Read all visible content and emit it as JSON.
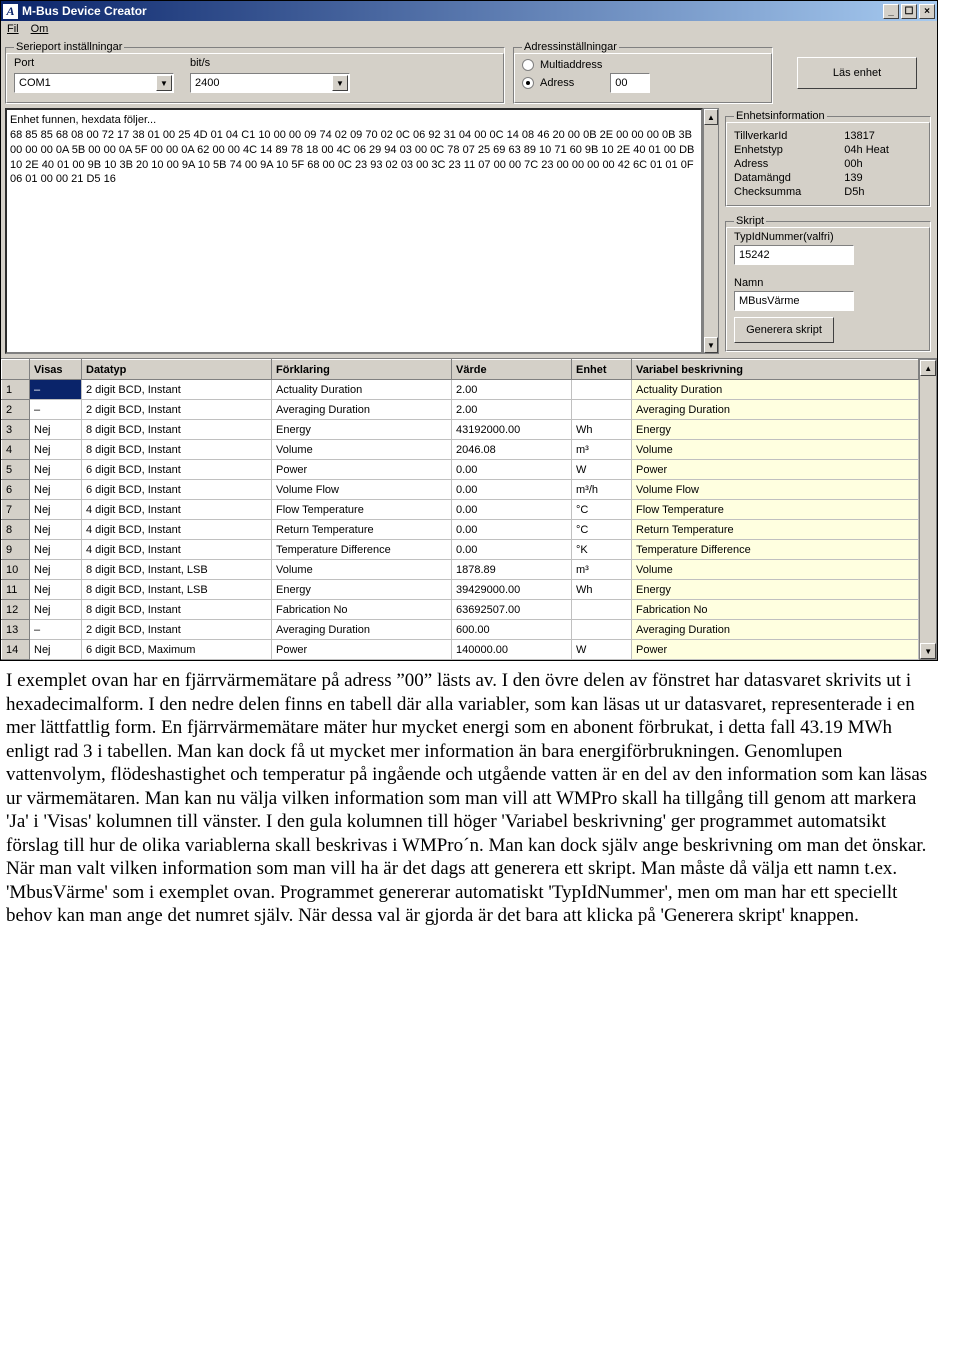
{
  "window": {
    "title": "M-Bus Device Creator",
    "menu": {
      "fil": "Fil",
      "om": "Om"
    }
  },
  "serieport": {
    "legend": "Serieport inställningar",
    "port_label": "Port",
    "port_value": "COM1",
    "bits_label": "bit/s",
    "bits_value": "2400"
  },
  "addr": {
    "legend": "Adressinställningar",
    "multi": "Multiaddress",
    "single": "Adress",
    "value": "00"
  },
  "read_btn": "Läs enhet",
  "hex": "Enhet funnen, hexdata följer...\n68 85 85 68 08 00 72 17 38 01 00 25 4D 01 04 C1 10 00 00 09 74 02 09 70 02 0C 06 92 31 04 00 0C 14 08 46 20 00 0B 2E 00 00 00 0B 3B 00 00 00 0A 5B 00 00 0A 5F 00 00 0A 62 00 00 4C 14 89 78 18 00 4C 06 29 94 03 00 0C 78 07 25 69 63 89 10 71 60 9B 10 2E 40 01 00 DB 10 2E 40 01 00 9B 10 3B 20 10 00 9A 10 5B 74 00 9A 10 5F 68 00 0C 23 93 02 03 00 3C 23 11 07 00 00 7C 23 00 00 00 00 42 6C 01 01 0F 06 01 00 00 21 D5 16",
  "enhet": {
    "legend": "Enhetsinformation",
    "k_manuf": "TillverkarId",
    "v_manuf": "13817",
    "k_type": "Enhetstyp",
    "v_type": "04h Heat",
    "k_addr": "Adress",
    "v_addr": "00h",
    "k_len": "Datamängd",
    "v_len": "139",
    "k_chk": "Checksumma",
    "v_chk": "D5h"
  },
  "skript": {
    "legend": "Skript",
    "typid_label": "TypIdNummer(valfri)",
    "typid": "15242",
    "name_label": "Namn",
    "name": "MBusVärme",
    "gen": "Generera skript"
  },
  "table": {
    "headers": [
      "",
      "Visas",
      "Datatyp",
      "Förklaring",
      "Värde",
      "Enhet",
      "Variabel beskrivning"
    ],
    "rows": [
      {
        "n": "1",
        "visas": "–",
        "dt": "2 digit BCD, Instant",
        "f": "Actuality Duration",
        "v": "2.00",
        "e": "",
        "vb": "Actuality Duration",
        "sel": true
      },
      {
        "n": "2",
        "visas": "–",
        "dt": "2 digit BCD, Instant",
        "f": "Averaging Duration",
        "v": "2.00",
        "e": "",
        "vb": "Averaging Duration"
      },
      {
        "n": "3",
        "visas": "Nej",
        "dt": "8 digit BCD, Instant",
        "f": "Energy",
        "v": "43192000.00",
        "e": "Wh",
        "vb": "Energy"
      },
      {
        "n": "4",
        "visas": "Nej",
        "dt": "8 digit BCD, Instant",
        "f": "Volume",
        "v": "2046.08",
        "e": "m³",
        "vb": "Volume"
      },
      {
        "n": "5",
        "visas": "Nej",
        "dt": "6 digit BCD, Instant",
        "f": "Power",
        "v": "0.00",
        "e": "W",
        "vb": "Power"
      },
      {
        "n": "6",
        "visas": "Nej",
        "dt": "6 digit BCD, Instant",
        "f": "Volume Flow",
        "v": "0.00",
        "e": "m³/h",
        "vb": "Volume Flow"
      },
      {
        "n": "7",
        "visas": "Nej",
        "dt": "4 digit BCD, Instant",
        "f": "Flow Temperature",
        "v": "0.00",
        "e": "°C",
        "vb": "Flow Temperature"
      },
      {
        "n": "8",
        "visas": "Nej",
        "dt": "4 digit BCD, Instant",
        "f": "Return Temperature",
        "v": "0.00",
        "e": "°C",
        "vb": "Return Temperature"
      },
      {
        "n": "9",
        "visas": "Nej",
        "dt": "4 digit BCD, Instant",
        "f": "Temperature Difference",
        "v": "0.00",
        "e": "°K",
        "vb": "Temperature Difference"
      },
      {
        "n": "10",
        "visas": "Nej",
        "dt": "8 digit BCD, Instant, LSB",
        "f": "Volume",
        "v": "1878.89",
        "e": "m³",
        "vb": "Volume"
      },
      {
        "n": "11",
        "visas": "Nej",
        "dt": "8 digit BCD, Instant, LSB",
        "f": "Energy",
        "v": "39429000.00",
        "e": "Wh",
        "vb": "Energy"
      },
      {
        "n": "12",
        "visas": "Nej",
        "dt": "8 digit BCD, Instant",
        "f": "Fabrication No",
        "v": "63692507.00",
        "e": "",
        "vb": "Fabrication No"
      },
      {
        "n": "13",
        "visas": "–",
        "dt": "2 digit BCD, Instant",
        "f": "Averaging Duration",
        "v": "600.00",
        "e": "",
        "vb": "Averaging Duration"
      },
      {
        "n": "14",
        "visas": "Nej",
        "dt": "6 digit BCD, Maximum",
        "f": "Power",
        "v": "140000.00",
        "e": "W",
        "vb": "Power"
      }
    ]
  },
  "paragraphs": [
    "I exemplet ovan har en fjärrvärmemätare på adress ”00” lästs av. I den övre delen av fönstret har datasvaret skrivits ut i hexadecimalform. I den nedre delen finns en tabell där alla variabler, som kan läsas ut ur datasvaret, representerade i en mer lättfattlig form. En fjärrvärmemätare mäter hur mycket energi som en abonent förbrukat, i detta fall 43.19 MWh enligt rad 3 i tabellen. Man kan dock få ut mycket mer information än bara energiförbrukningen. Genomlupen vattenvolym, flödeshastighet och temperatur på ingående och utgående vatten är en del av den information som kan läsas ur värmemätaren. Man kan nu välja vilken information som man vill att WMPro skall ha tillgång till genom att markera 'Ja' i 'Visas' kolumnen till vänster. I den gula kolumnen till höger 'Variabel beskrivning' ger programmet automatsikt förslag till hur de olika variablerna skall beskrivas i WMPro´n. Man kan dock själv ange beskrivning om man det önskar.",
    "När man valt vilken information som man vill ha är det dags att generera ett skript. Man måste då välja ett namn t.ex. 'MbusVärme' som i exemplet ovan. Programmet genererar automatiskt 'TypIdNummer', men om man har ett speciellt behov kan man ange det numret själv. När dessa val är gjorda är det bara att klicka på 'Generera skript' knappen."
  ]
}
